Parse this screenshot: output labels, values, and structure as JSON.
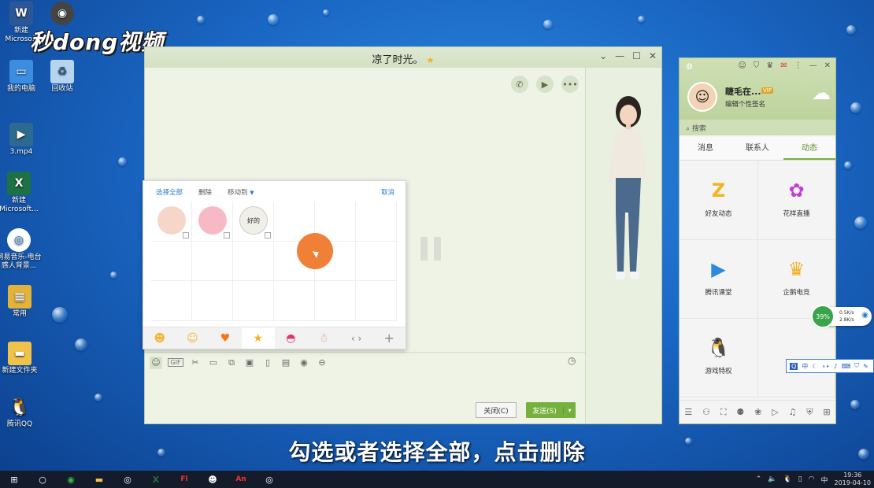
{
  "watermark": "秒dong视频",
  "desktop": {
    "icons": [
      {
        "label": "新建\nMicrosoft",
        "icon": "word-icon"
      },
      {
        "label": "",
        "icon": "camera-app-icon"
      },
      {
        "label": "我的电脑",
        "icon": "computer-icon"
      },
      {
        "label": "回收站",
        "icon": "recycle-bin-icon"
      },
      {
        "label": "3.mp4",
        "icon": "video-file-icon"
      },
      {
        "label": "新建\nMicrosoft...",
        "icon": "excel-icon"
      },
      {
        "label": "网易音乐-电台\n感人背景...",
        "icon": "music-icon"
      },
      {
        "label": "常用",
        "icon": "folder-icon"
      },
      {
        "label": "新建文件夹",
        "icon": "folder-icon"
      },
      {
        "label": "腾讯QQ",
        "icon": "qq-penguin-icon"
      }
    ]
  },
  "chat": {
    "title": "凉了时光。",
    "buttons": {
      "close": "关闭(C)",
      "send": "发送(S)"
    }
  },
  "popup": {
    "select_all": "选择全部",
    "delete": "删除",
    "move_to": "移动到",
    "cancel": "取消",
    "stickers": [
      {
        "name": "cat-sticker",
        "color": "#f5d6c8"
      },
      {
        "name": "pink-blob-sticker",
        "color": "#f7b9c4"
      },
      {
        "name": "good-sticker",
        "color": "#f0f0e8",
        "text": "好的"
      }
    ]
  },
  "qq": {
    "nickname": "睫毛在...",
    "vip": "VIP",
    "signature": "编辑个性签名",
    "search_placeholder": "搜索",
    "tabs": [
      "消息",
      "联系人",
      "动态"
    ],
    "active_tab": "动态",
    "apps": [
      {
        "label": "好友动态",
        "icon": "friends-feed-icon",
        "color": "#f3b51c"
      },
      {
        "label": "花样直播",
        "icon": "live-star-icon",
        "color": "#c43dd6"
      },
      {
        "label": "腾讯课堂",
        "icon": "classroom-play-icon",
        "color": "#2c8be0"
      },
      {
        "label": "企鹅电竞",
        "icon": "esports-crown-icon",
        "color": "#f0b020"
      },
      {
        "label": "游戏特权",
        "icon": "game-penguin-icon",
        "color": "#d8242b"
      }
    ]
  },
  "net_widget": {
    "percent": "39%",
    "up": "0.5K/s",
    "down": "2.8K/s"
  },
  "ime": {
    "lang": "中"
  },
  "subtitle": "勾选或者选择全部，点击删除",
  "taskbar": {
    "time": "19:36",
    "date": "2019-04-10",
    "lang": "中"
  }
}
